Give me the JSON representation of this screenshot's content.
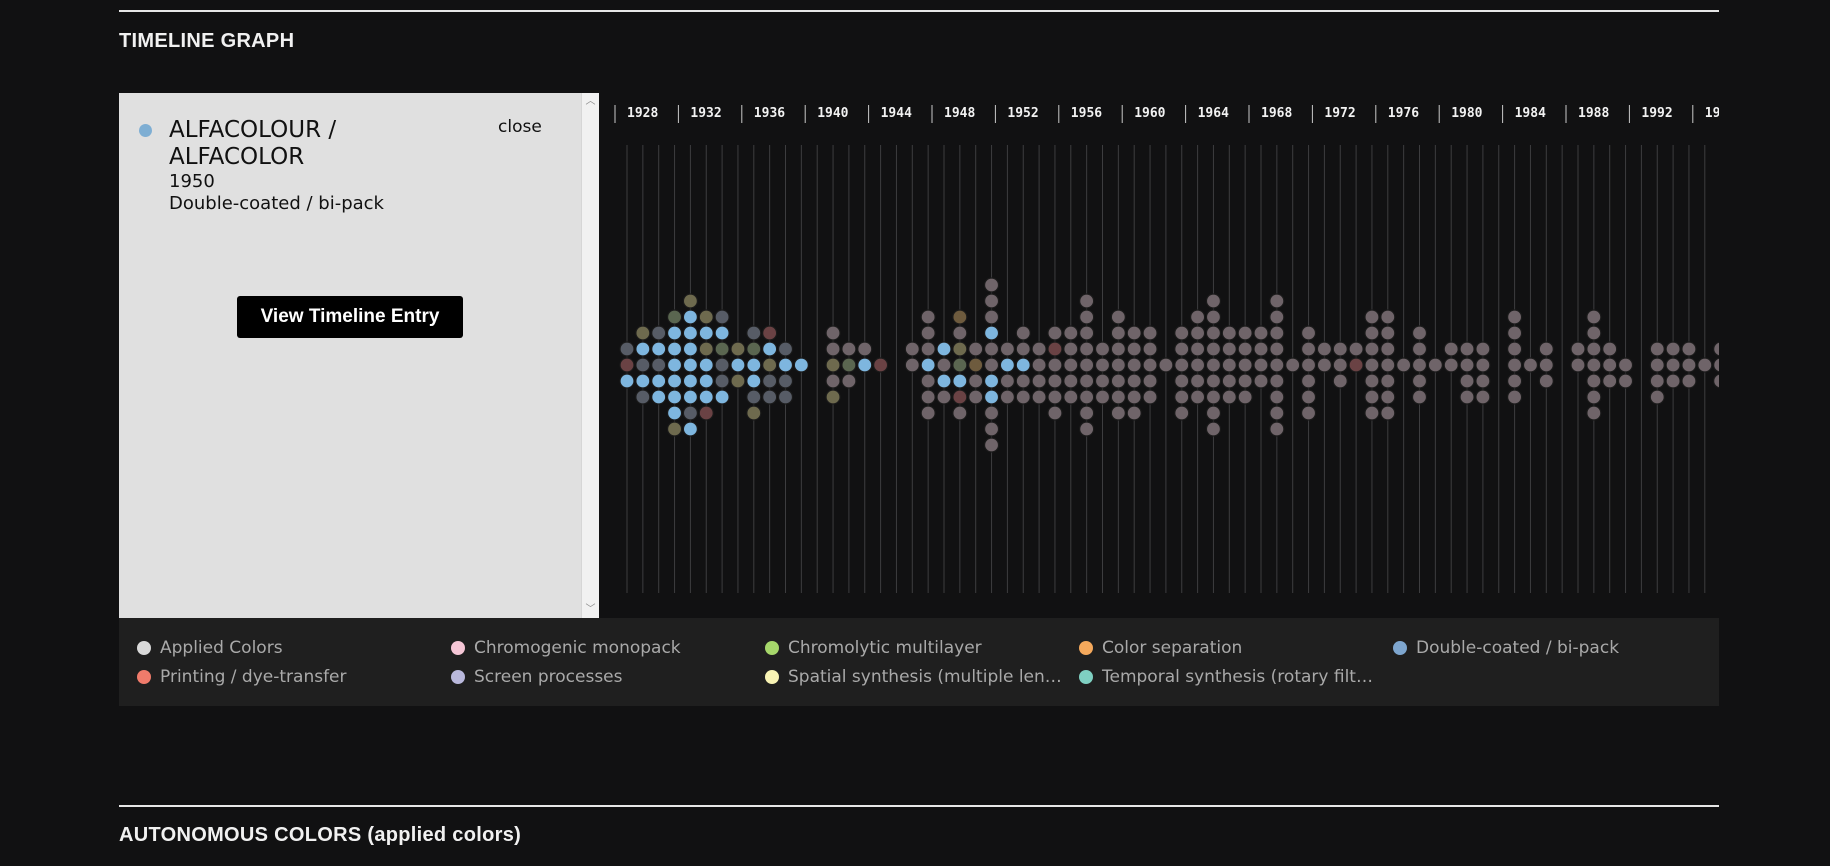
{
  "timeline_section": {
    "title": "TIMELINE GRAPH"
  },
  "autonomous_section": {
    "title": "AUTONOMOUS COLORS (applied colors)"
  },
  "selected": {
    "name": "ALFACOLOUR / ALFACOLOR",
    "year": "1950",
    "process": "Double-coated / bi-pack",
    "close_label": "close",
    "button_label": "View Timeline Entry",
    "color": "#7eaed3"
  },
  "axis": {
    "years": [
      "1928",
      "1932",
      "1936",
      "1940",
      "1944",
      "1948",
      "1952",
      "1956",
      "1960",
      "1964",
      "1968",
      "1972",
      "1976",
      "1980",
      "1984",
      "1988",
      "1992",
      "19"
    ]
  },
  "legend": [
    {
      "label": "Applied Colors",
      "color": "#d9d9d9"
    },
    {
      "label": "Chromogenic monopack",
      "color": "#f5c6d6"
    },
    {
      "label": "Chromolytic multilayer",
      "color": "#a6d76b"
    },
    {
      "label": "Color separation",
      "color": "#f5a95c"
    },
    {
      "label": "Double-coated / bi-pack",
      "color": "#7ea6cf"
    },
    {
      "label": "Printing / dye-transfer",
      "color": "#f07b6b"
    },
    {
      "label": "Screen processes",
      "color": "#b9b8dc"
    },
    {
      "label": "Spatial synthesis (multiple lenses, prisms)",
      "color": "#f8f3b4"
    },
    {
      "label": "Temporal synthesis (rotary filters)",
      "color": "#7fd0c2"
    }
  ],
  "dot_colors": {
    "default": "#6f6469",
    "double_coated": "#7eb6df",
    "olive": "#6e6a4e",
    "green": "#5a6650",
    "red": "#6a4244",
    "slate": "#575c66",
    "brown": "#6e5b3e"
  }
}
